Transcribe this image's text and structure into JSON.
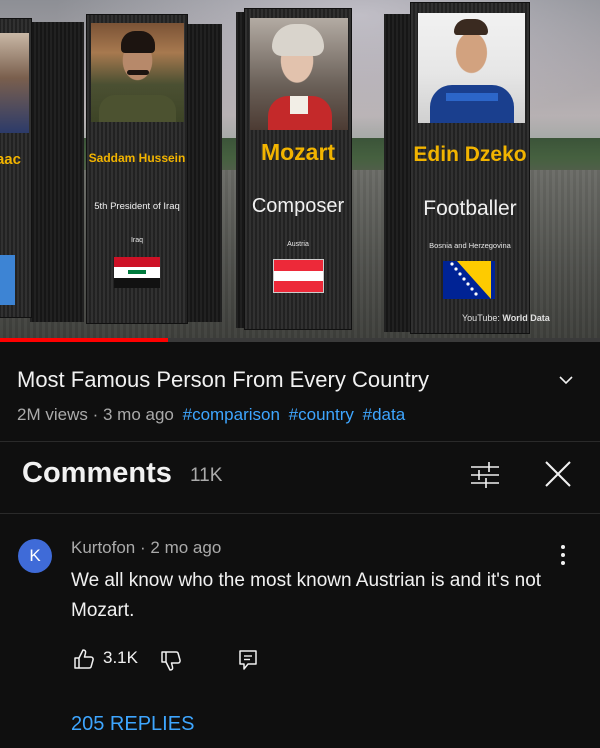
{
  "video": {
    "watermark_prefix": "YouTube:",
    "watermark_channel": "World Data",
    "progress_fraction": 0.28,
    "cards": [
      {
        "name": "aac",
        "title": "",
        "country": ""
      },
      {
        "name": "Saddam Hussein",
        "title": "5th President of Iraq",
        "country": "Iraq"
      },
      {
        "name": "Mozart",
        "title": "Composer",
        "country": "Austria"
      },
      {
        "name": "Edin Dzeko",
        "title": "Footballer",
        "country": "Bosnia and Herzegovina"
      }
    ]
  },
  "info": {
    "title": "Most Famous Person From Every Country",
    "views": "2M views",
    "age": "3 mo ago",
    "tags": [
      "#comparison",
      "#country",
      "#data"
    ]
  },
  "comments_header": {
    "label": "Comments",
    "count": "11K"
  },
  "comment": {
    "avatar_letter": "K",
    "author": "Kurtofon",
    "time": "2 mo ago",
    "text": "We all know who the most known Austrian is and it's not Mozart.",
    "likes": "3.1K",
    "replies_label": "205 REPLIES"
  },
  "colors": {
    "background": "#0f0f0f",
    "link": "#3ea6ff",
    "avatar": "#3f6bd8",
    "progress": "#ff0000",
    "name_gold": "#f2b400"
  },
  "icons": [
    "chevron-down-icon",
    "filter-sliders-icon",
    "close-icon",
    "more-vert-icon",
    "thumb-up-icon",
    "thumb-down-icon",
    "reply-comment-icon"
  ]
}
